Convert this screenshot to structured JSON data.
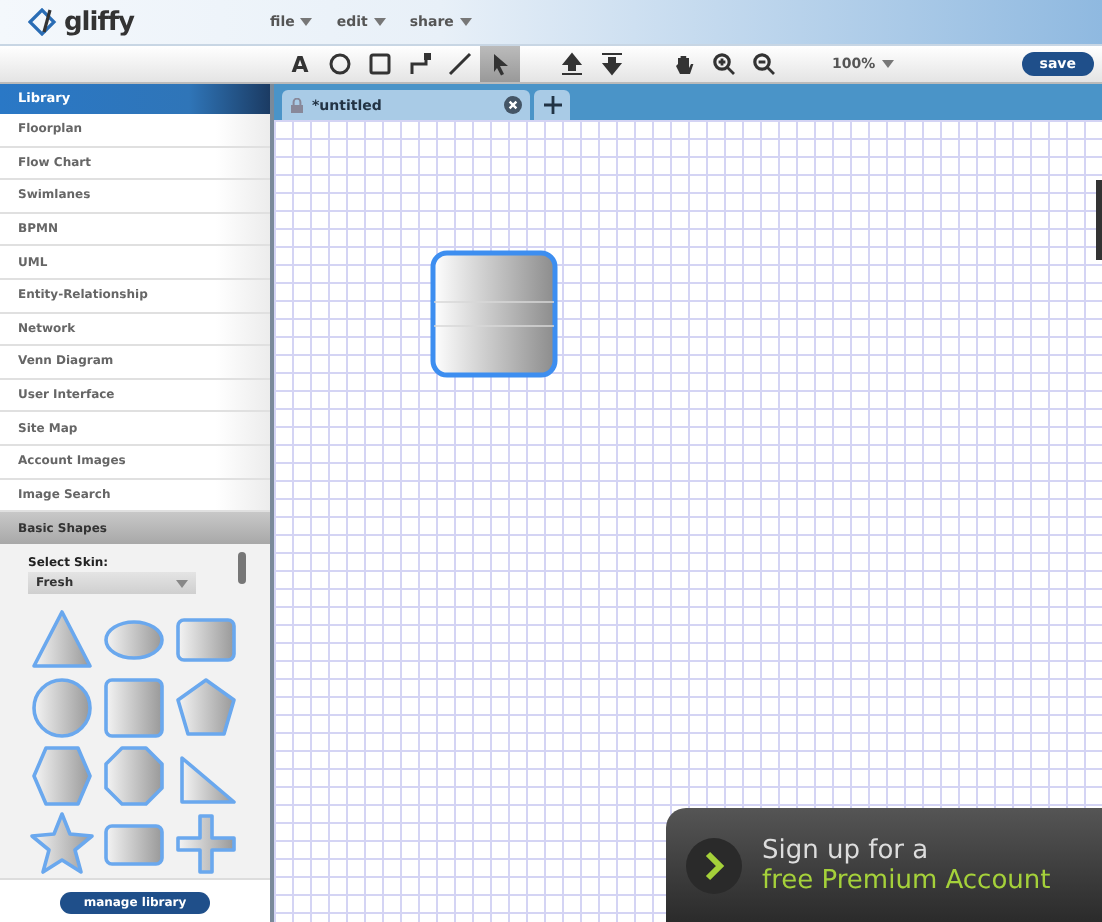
{
  "app": {
    "logo": "gliffy"
  },
  "menus": [
    {
      "label": "file"
    },
    {
      "label": "edit"
    },
    {
      "label": "share"
    }
  ],
  "tools": [
    {
      "kind": "text",
      "label": "A",
      "selected": false
    },
    {
      "kind": "ellipse",
      "selected": false
    },
    {
      "kind": "rect",
      "selected": false
    },
    {
      "kind": "connector",
      "selected": false
    },
    {
      "kind": "line",
      "selected": false
    },
    {
      "kind": "pointer",
      "selected": true
    },
    {
      "kind": "gap"
    },
    {
      "kind": "front",
      "selected": false
    },
    {
      "kind": "back",
      "selected": false
    },
    {
      "kind": "gap"
    },
    {
      "kind": "hand",
      "selected": false
    },
    {
      "kind": "zoomin",
      "selected": false
    },
    {
      "kind": "zoomout",
      "selected": false
    }
  ],
  "zoom": {
    "value": "100%"
  },
  "save_button": "save",
  "sidebar": {
    "header": "Library",
    "items": [
      {
        "label": "Floorplan"
      },
      {
        "label": "Flow Chart"
      },
      {
        "label": "Swimlanes"
      },
      {
        "label": "BPMN"
      },
      {
        "label": "UML"
      },
      {
        "label": "Entity-Relationship"
      },
      {
        "label": "Network"
      },
      {
        "label": "Venn Diagram"
      },
      {
        "label": "User Interface"
      },
      {
        "label": "Site Map"
      },
      {
        "label": "Account Images"
      },
      {
        "label": "Image Search"
      }
    ],
    "section": {
      "label": "Basic Shapes",
      "expanded": true
    },
    "skin_label": "Select Skin:",
    "skin": "Fresh",
    "shapes": [
      {
        "kind": "triangle"
      },
      {
        "kind": "ellipse"
      },
      {
        "kind": "rect"
      },
      {
        "kind": "circle"
      },
      {
        "kind": "square"
      },
      {
        "kind": "pentagon"
      },
      {
        "kind": "hexagon"
      },
      {
        "kind": "octagon"
      },
      {
        "kind": "right-triangle"
      },
      {
        "kind": "star"
      },
      {
        "kind": "rounded-rect"
      },
      {
        "kind": "cross"
      }
    ],
    "manage_button": "manage library"
  },
  "tabs": [
    {
      "label": "*untitled",
      "selected": true
    }
  ],
  "promo": {
    "line1": "Sign up for a",
    "line2": "free Premium Account"
  }
}
